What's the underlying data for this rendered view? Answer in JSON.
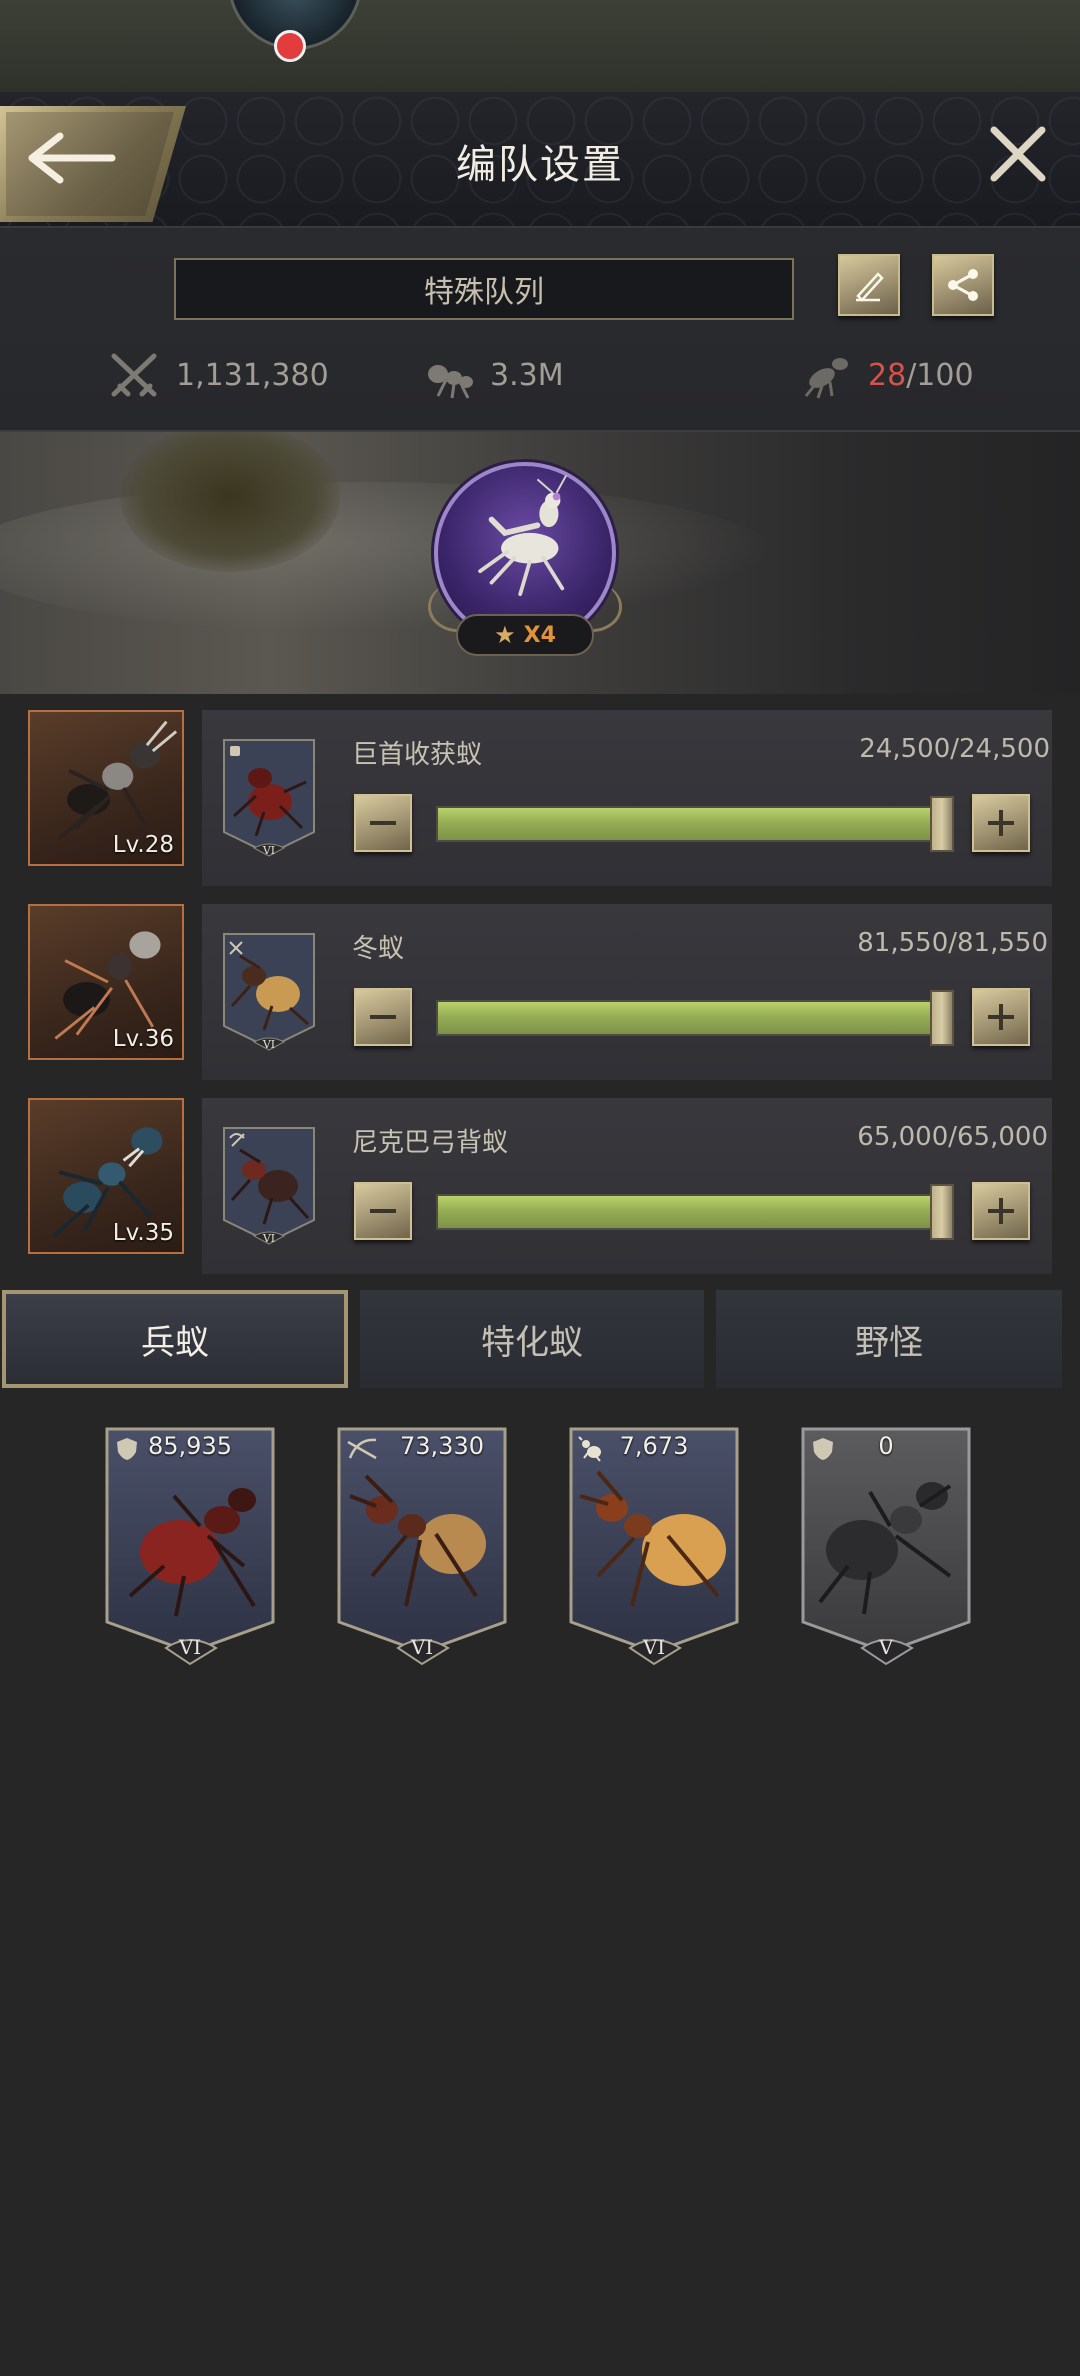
{
  "header": {
    "title": "编队设置"
  },
  "queue": {
    "name": "特殊队列",
    "power": "1,131,380",
    "load": "3.3M",
    "capacity_used": "28",
    "capacity_total": "/100"
  },
  "hero": {
    "stars_label": "X4"
  },
  "troops": [
    {
      "portrait_level": "Lv.28",
      "name": "巨首收获蚁",
      "count": "24,500/24,500",
      "tier": "VI",
      "fill": 1.0
    },
    {
      "portrait_level": "Lv.36",
      "name": "冬蚁",
      "count": "81,550/81,550",
      "tier": "VI",
      "fill": 1.0
    },
    {
      "portrait_level": "Lv.35",
      "name": "尼克巴弓背蚁",
      "count": "65,000/65,000",
      "tier": "VI",
      "fill": 1.0
    }
  ],
  "tabs": [
    {
      "label": "兵蚁",
      "active": true
    },
    {
      "label": "特化蚁",
      "active": false
    },
    {
      "label": "野怪",
      "active": false
    }
  ],
  "units": [
    {
      "count": "85,935",
      "tier": "VI",
      "icon": "shield-icon"
    },
    {
      "count": "73,330",
      "tier": "VI",
      "icon": "bow-icon"
    },
    {
      "count": "7,673",
      "tier": "VI",
      "icon": "ant-icon"
    },
    {
      "count": "0",
      "tier": "V",
      "icon": "shield-icon"
    }
  ],
  "colors": {
    "accent_gold": "#a39670",
    "slider_green": "#96ad55",
    "capacity_red": "#d2544a",
    "star_orange": "#e0933b"
  }
}
